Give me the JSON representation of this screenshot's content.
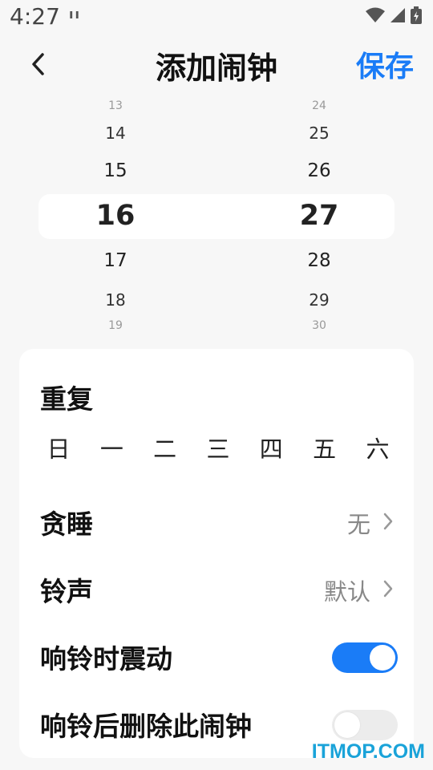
{
  "status_bar": {
    "time": "4:27",
    "notification": "ıı"
  },
  "header": {
    "title": "添加闹钟",
    "save_label": "保存"
  },
  "picker": {
    "hours": [
      "13",
      "14",
      "15",
      "16",
      "17",
      "18",
      "19"
    ],
    "minutes": [
      "24",
      "25",
      "26",
      "27",
      "28",
      "29",
      "30"
    ],
    "selected_hour": "16",
    "selected_minute": "27"
  },
  "repeat": {
    "title": "重复",
    "days": [
      "日",
      "一",
      "二",
      "三",
      "四",
      "五",
      "六"
    ]
  },
  "settings": {
    "snooze": {
      "label": "贪睡",
      "value": "无"
    },
    "ringtone": {
      "label": "铃声",
      "value": "默认"
    },
    "vibrate": {
      "label": "响铃时震动",
      "enabled": true
    },
    "delete_after": {
      "label": "响铃后删除此闹钟",
      "enabled": false
    }
  },
  "colors": {
    "accent": "#1a7cf7",
    "background": "#f7f7f7",
    "card": "#ffffff"
  },
  "watermark": "ITMOP.COM"
}
